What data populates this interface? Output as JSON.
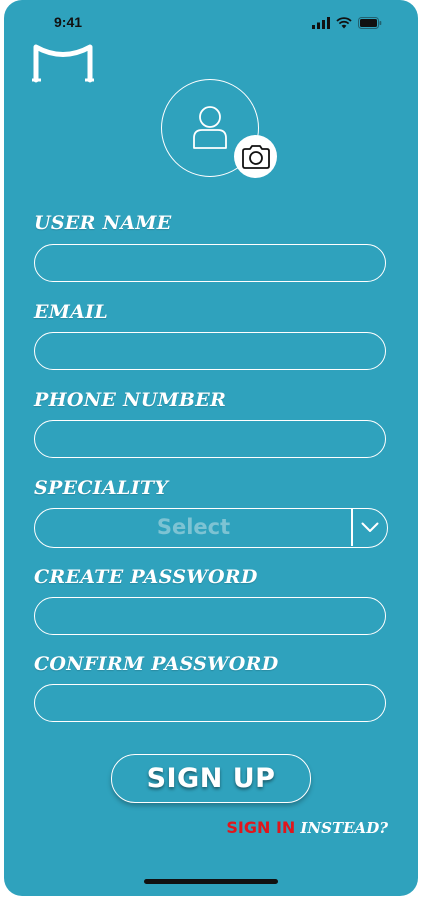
{
  "status_bar": {
    "time": "9:41",
    "icons": [
      "signal-icon",
      "wifi-icon",
      "battery-icon"
    ]
  },
  "logo": {
    "icon": "m-logo-icon"
  },
  "avatar": {
    "icon": "person-icon",
    "camera_icon": "camera-icon"
  },
  "form": {
    "username": {
      "label": "USER NAME",
      "value": ""
    },
    "email": {
      "label": "EMAIL",
      "value": ""
    },
    "phone": {
      "label": "PHONE NUMBER",
      "value": ""
    },
    "speciality": {
      "label": "SPECIALITY",
      "selected": "Select"
    },
    "create_password": {
      "label": "CREATE PASSWORD",
      "value": ""
    },
    "confirm_password": {
      "label": "CONFIRM PASSWORD",
      "value": ""
    }
  },
  "actions": {
    "signup_label": "SIGN UP",
    "signin_label": "SIGN IN",
    "instead_label": "INSTEAD?"
  },
  "colors": {
    "background": "#2fa2bd",
    "signin": "#e0161c",
    "select_placeholder": "#7dc3d3"
  }
}
